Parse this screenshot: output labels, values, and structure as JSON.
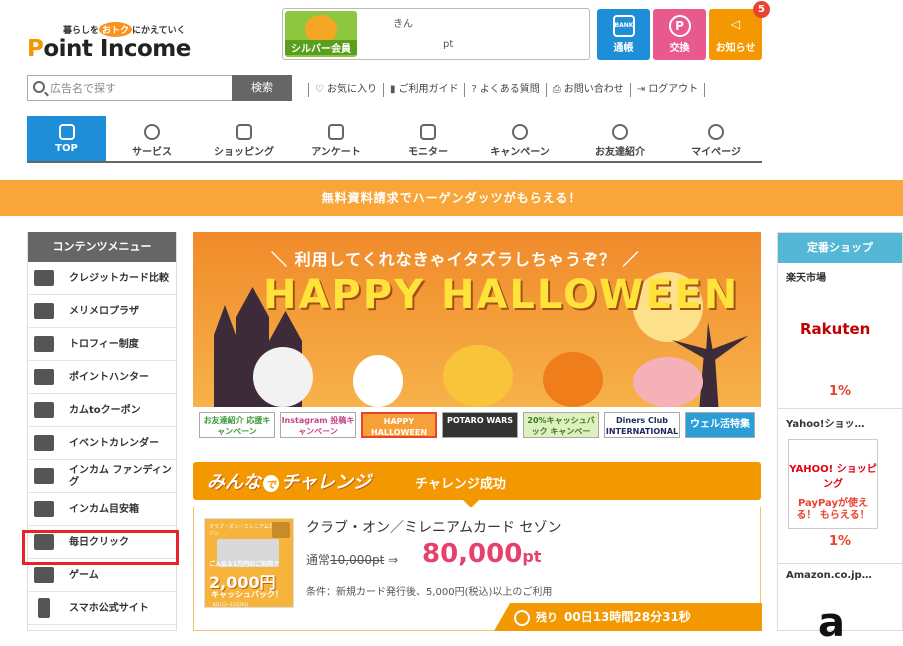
{
  "header": {
    "logo_tagline_pre": "暮らしを",
    "logo_tagline_mid": "おトク",
    "logo_tagline_post": "にかえていく",
    "logo_name_first": "P",
    "logo_name_rest": "oint Income",
    "member_badge": "シルバー会員",
    "member_line1": "きん",
    "member_line2": "pt",
    "buttons": [
      {
        "label": "通帳",
        "icon": "bank-icon",
        "glyph": "BANK"
      },
      {
        "label": "交換",
        "icon": "exchange-icon",
        "glyph": "P"
      },
      {
        "label": "お知らせ",
        "icon": "megaphone-icon",
        "glyph": "◁"
      }
    ],
    "notify_count": "5"
  },
  "search": {
    "placeholder": "広告名で探す",
    "button": "検索"
  },
  "subnav": [
    {
      "label": "お気に入り",
      "icon": "heart-icon",
      "glyph": "♡"
    },
    {
      "label": "ご利用ガイド",
      "icon": "book-icon",
      "glyph": "▮"
    },
    {
      "label": "よくある質問",
      "icon": "question-icon",
      "glyph": "?"
    },
    {
      "label": "お問い合わせ",
      "icon": "printer-icon",
      "glyph": "⎙"
    },
    {
      "label": "ログアウト",
      "icon": "logout-icon",
      "glyph": "⇥"
    }
  ],
  "mainnav": [
    {
      "label": "TOP",
      "icon": "home-icon"
    },
    {
      "label": "サービス",
      "icon": "bulb-icon"
    },
    {
      "label": "ショッピング",
      "icon": "cart-icon"
    },
    {
      "label": "アンケート",
      "icon": "pencil-icon"
    },
    {
      "label": "モニター",
      "icon": "clipboard-icon"
    },
    {
      "label": "キャンペーン",
      "icon": "medal-icon"
    },
    {
      "label": "お友達紹介",
      "icon": "friends-icon"
    },
    {
      "label": "マイページ",
      "icon": "gauge-icon"
    }
  ],
  "banner": "無料資料請求でハーゲンダッツがもらえる！",
  "sidemenu": {
    "title": "コンテンツメニュー",
    "items": [
      {
        "label": "クレジットカード比較",
        "icon": "credit-card-icon"
      },
      {
        "label": "メリメロプラザ",
        "icon": "monitor-icon"
      },
      {
        "label": "トロフィー制度",
        "icon": "trophy-icon"
      },
      {
        "label": "ポイントハンター",
        "icon": "swords-icon"
      },
      {
        "label": "カムtoクーポン",
        "icon": "pen-icon"
      },
      {
        "label": "イベントカレンダー",
        "icon": "calendar-icon"
      },
      {
        "label": "インカム ファンディング",
        "icon": "tag-icon"
      },
      {
        "label": "インカム目安箱",
        "icon": "box-icon"
      },
      {
        "label": "毎日クリック",
        "icon": "hand-click-icon"
      },
      {
        "label": "ゲーム",
        "icon": "gamepad-icon"
      },
      {
        "label": "スマホ公式サイト",
        "icon": "smartphone-icon"
      }
    ]
  },
  "hero": {
    "subtitle": "＼ 利用してくれなきゃイタズラしちゃうぞ？ ／",
    "title": "HAPPY HALLOWEEN",
    "thumbs": [
      {
        "label": "お友達紹介 応援キャンペーン"
      },
      {
        "label": "Instagram 投稿キャンペーン"
      },
      {
        "label": "HAPPY HALLOWEEN"
      },
      {
        "label": "POTARO WARS"
      },
      {
        "label": "20%キャッシュバック キャンペーン！"
      },
      {
        "label": "Diners Club INTERNATIONAL"
      },
      {
        "label": "ウェル活特集"
      }
    ]
  },
  "challenge": {
    "logo_pre": "みんな",
    "logo_de": "で",
    "logo_post": "チャレンジ",
    "text": "チャレンジ成功"
  },
  "offer": {
    "name": "クラブ・オン／ミレニアムカード セゾン",
    "was_label": "通常",
    "was_value": "10,000pt",
    "arrow": "⇒",
    "now_value": "80,000",
    "now_unit": "pt",
    "condition": "条件：新規カード発行後、5,000円(税込)以上のご利用",
    "card_top": "クラブ・オン／ミレニアムカード セゾン",
    "card_line1": "ご入会＆1万円のご利用で",
    "card_amount": "2,000円",
    "card_line2": "キャッシュバック！",
    "card_period": "8月1日〜11月30日",
    "timer_label": "残り",
    "timer_value": "00日13時間28分31秒"
  },
  "shops": {
    "title": "定番ショップ",
    "items": [
      {
        "name": "楽天市場",
        "logo": "Rakuten",
        "rate": "1%"
      },
      {
        "name": "Yahoo!ショッ…",
        "logo_line1": "YAHOO! ショッピング",
        "logo_line2": "PayPayが使える！ もらえる！",
        "rate": "1%"
      },
      {
        "name": "Amazon.co.jp…",
        "logo": "a"
      }
    ]
  },
  "colors": {
    "accent_blue": "#1f8ed8",
    "orange": "#f39800",
    "pink": "#e85a8e",
    "highlight_red": "#e8222a",
    "price_pink": "#e5416c"
  }
}
